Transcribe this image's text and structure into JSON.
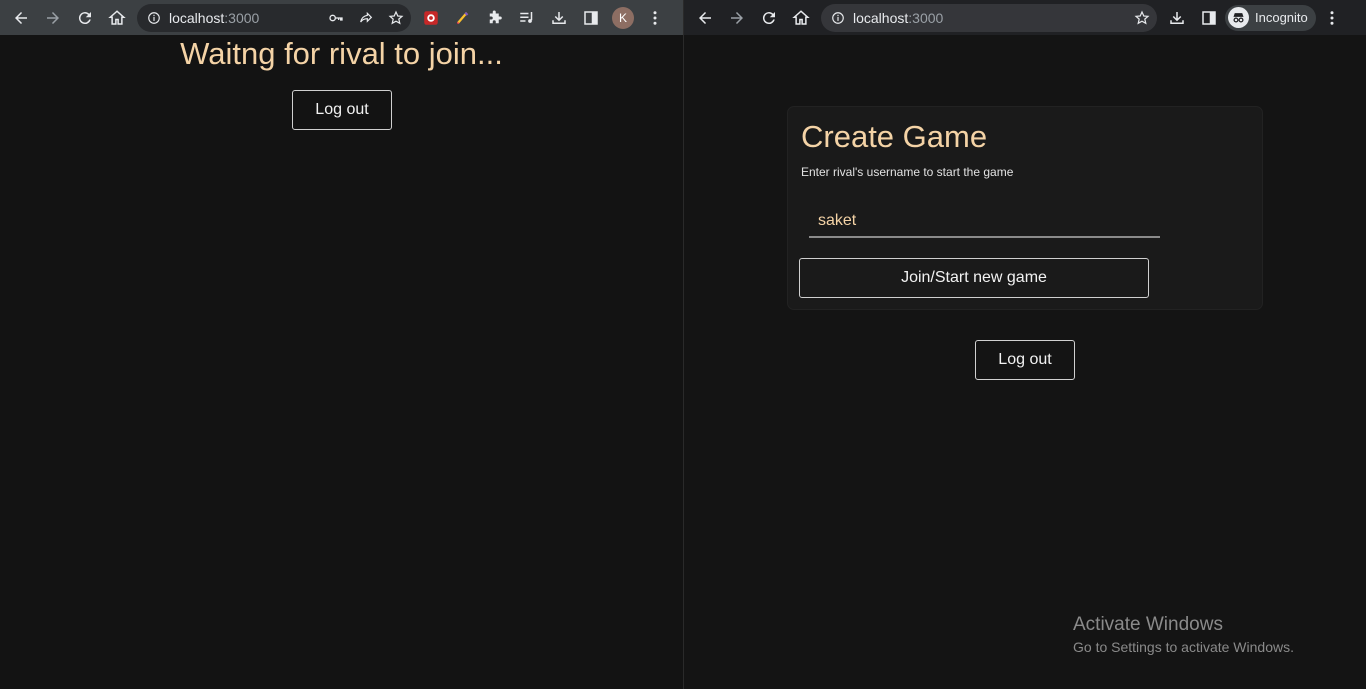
{
  "left_window": {
    "url_host": "localhost",
    "url_port": ":3000",
    "profile_initial": "K",
    "heading": "Waitng for rival to join...",
    "logout_label": "Log out"
  },
  "right_window": {
    "url_host": "localhost",
    "url_port": ":3000",
    "incognito_label": "Incognito",
    "card": {
      "title": "Create Game",
      "subtitle": "Enter rival's username to start the game",
      "username_value": "saket",
      "join_label": "Join/Start new game"
    },
    "logout_label": "Log out",
    "watermark": {
      "line1": "Activate Windows",
      "line2": "Go to Settings to activate Windows."
    }
  },
  "colors": {
    "accent": "#f4d3a6",
    "background": "#131313",
    "card": "#1a1a1a"
  }
}
